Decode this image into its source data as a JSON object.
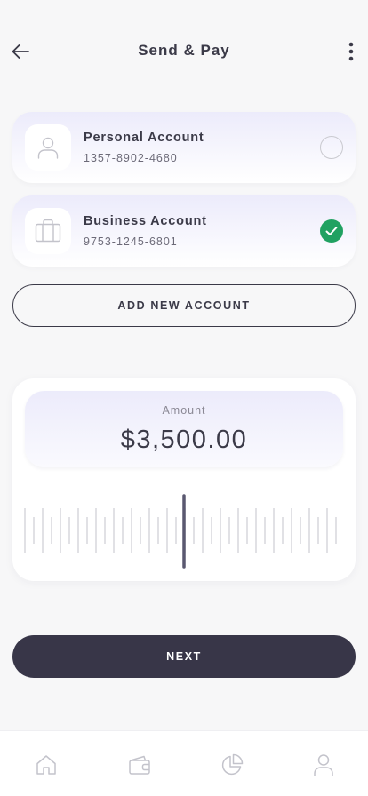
{
  "header": {
    "title": "Send & Pay",
    "back_icon": "arrow-left-icon",
    "more_icon": "more-vertical-icon"
  },
  "accounts": [
    {
      "name": "Personal Account",
      "number": "1357-8902-4680",
      "icon": "user-icon",
      "selected": false
    },
    {
      "name": "Business Account",
      "number": "9753-1245-6801",
      "icon": "briefcase-icon",
      "selected": true
    }
  ],
  "add_account_label": "ADD NEW ACCOUNT",
  "amount": {
    "label": "Amount",
    "value": "$3,500.00"
  },
  "next_label": "NEXT",
  "bottom_nav": [
    {
      "icon": "home-icon"
    },
    {
      "icon": "wallet-icon"
    },
    {
      "icon": "pie-chart-icon"
    },
    {
      "icon": "profile-icon"
    }
  ],
  "colors": {
    "primary": "#383648",
    "success": "#20a161",
    "card_gradient_top": "#ecebfb",
    "background": "#f7f7f8"
  }
}
